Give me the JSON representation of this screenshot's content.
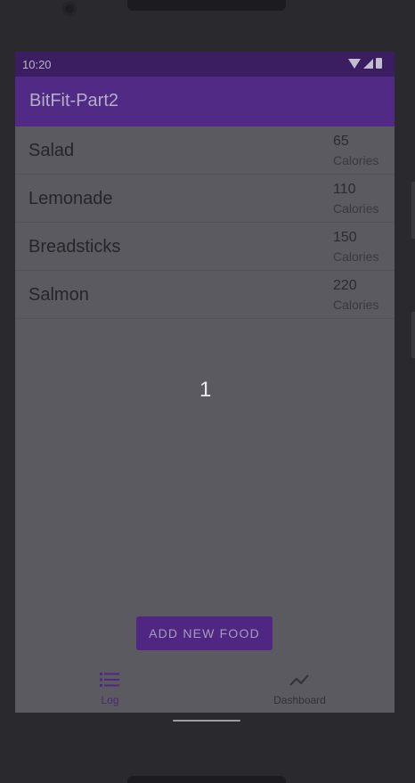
{
  "status_bar": {
    "time": "10:20"
  },
  "app_bar": {
    "title": "BitFit-Part2"
  },
  "food_list": [
    {
      "name": "Salad",
      "calories": "65",
      "unit": "Calories"
    },
    {
      "name": "Lemonade",
      "calories": "110",
      "unit": "Calories"
    },
    {
      "name": "Breadsticks",
      "calories": "150",
      "unit": "Calories"
    },
    {
      "name": "Salmon",
      "calories": "220",
      "unit": "Calories"
    }
  ],
  "overlay_number": "1",
  "add_button": {
    "label": "ADD NEW FOOD"
  },
  "bottom_nav": {
    "items": [
      {
        "label": "Log",
        "icon": "list-icon",
        "selected": true
      },
      {
        "label": "Dashboard",
        "icon": "trending-icon",
        "selected": false
      }
    ]
  },
  "colors": {
    "primary": "#502a85",
    "status_bar": "#3b1d61",
    "scrim_background": "#5b5a60"
  }
}
